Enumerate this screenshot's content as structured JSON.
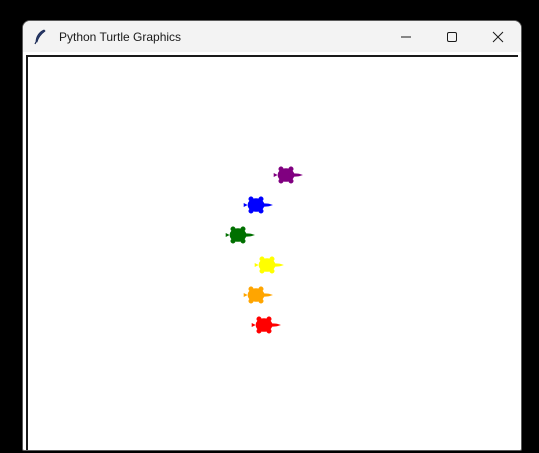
{
  "window": {
    "title": "Python Turtle Graphics",
    "app_icon": "feather-icon",
    "controls": [
      {
        "name": "minimize-button",
        "icon": "minimize-icon"
      },
      {
        "name": "maximize-button",
        "icon": "maximize-icon"
      },
      {
        "name": "close-button",
        "icon": "close-icon"
      }
    ]
  },
  "canvas": {
    "background": "#ffffff",
    "turtles": [
      {
        "color": "#800080"
      },
      {
        "color": "#0000ff"
      },
      {
        "color": "#007000"
      },
      {
        "color": "#ffff00"
      },
      {
        "color": "#ffa500"
      },
      {
        "color": "#ff0000"
      }
    ]
  }
}
